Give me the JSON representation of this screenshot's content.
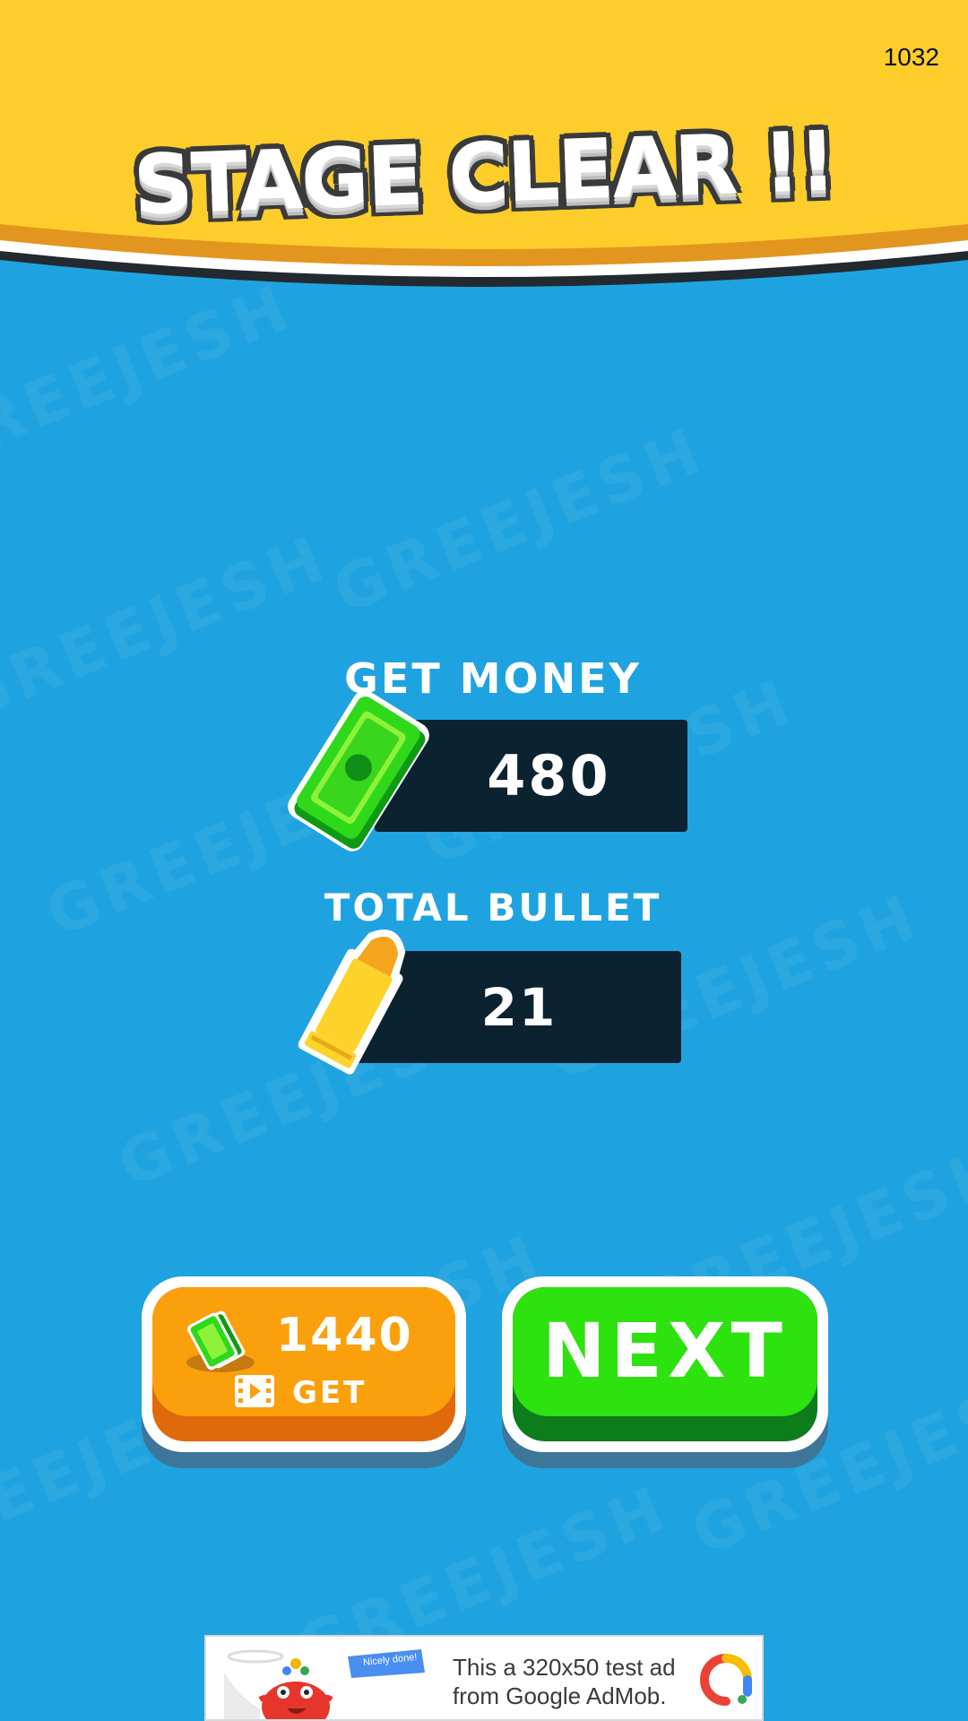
{
  "colors": {
    "background": "#1fa3e0",
    "header": "#fdcd2c",
    "stat_box": "#0b2230",
    "get_button": "#fba00d",
    "next_button": "#2ee20f"
  },
  "header": {
    "coin_count": "1032",
    "title": "STAGE CLEAR !!"
  },
  "watermark": {
    "text": "GREEJESH"
  },
  "stats": {
    "money": {
      "label": "GET MONEY",
      "value": "480",
      "icon": "cash-bill-icon"
    },
    "bullets": {
      "label": "TOTAL BULLET",
      "value": "21",
      "icon": "bullet-icon"
    }
  },
  "buttons": {
    "get": {
      "amount": "1440",
      "label": "GET",
      "icons": [
        "cash-stack-icon",
        "video-ad-icon"
      ]
    },
    "next": {
      "label": "NEXT"
    }
  },
  "ad": {
    "text": "This a 320x50 test ad from Google AdMob.",
    "badge": "Nicely done!",
    "icons": [
      "mascot-icon",
      "admob-logo-icon"
    ]
  }
}
